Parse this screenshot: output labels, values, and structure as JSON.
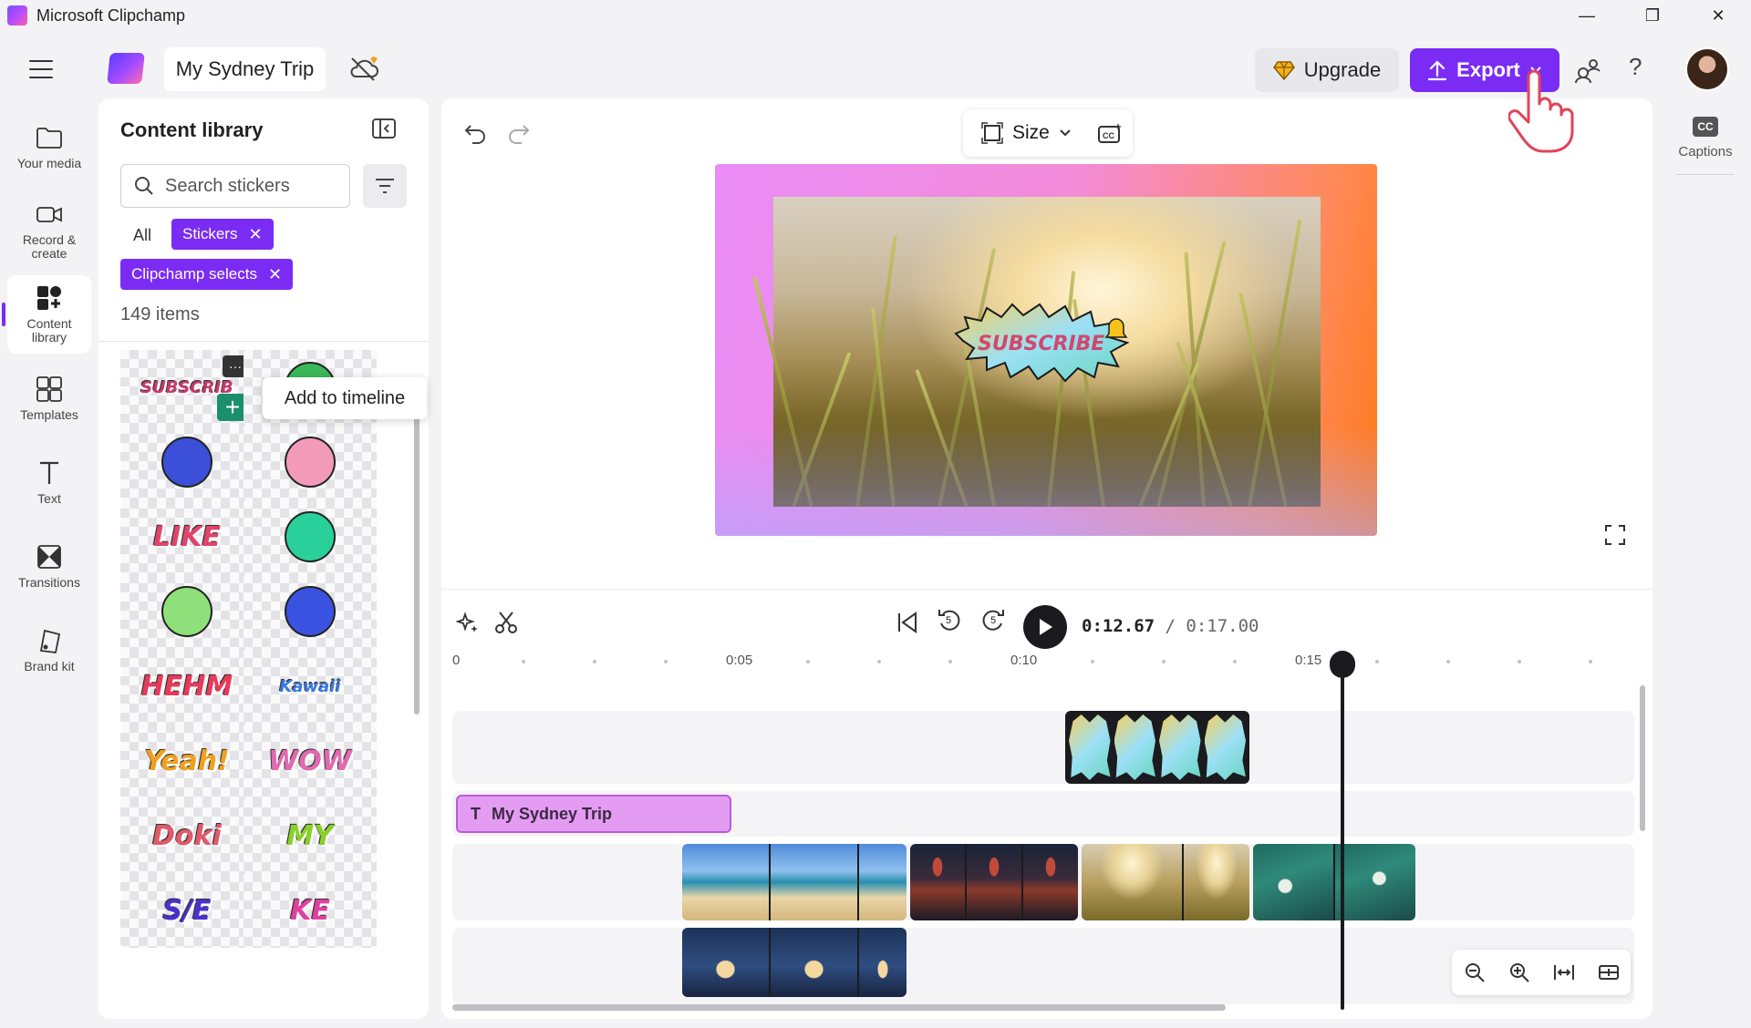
{
  "app": {
    "title": "Microsoft Clipchamp"
  },
  "window_controls": {
    "minimize": "—",
    "restore": "❐",
    "close": "✕"
  },
  "topbar": {
    "project_title": "My Sydney Trip",
    "upgrade_label": "Upgrade",
    "export_label": "Export",
    "help_label": "?"
  },
  "left_rail": [
    {
      "icon": "folder-icon",
      "label": "Your media"
    },
    {
      "icon": "camera-icon",
      "label": "Record &\ncreate"
    },
    {
      "icon": "content-library-icon",
      "label": "Content\nlibrary",
      "active": true
    },
    {
      "icon": "templates-icon",
      "label": "Templates"
    },
    {
      "icon": "text-icon",
      "label": "Text"
    },
    {
      "icon": "transitions-icon",
      "label": "Transitions"
    },
    {
      "icon": "brand-kit-icon",
      "label": "Brand kit"
    }
  ],
  "library": {
    "title": "Content library",
    "search_placeholder": "Search stickers",
    "filter_all": "All",
    "chips": [
      "Stickers",
      "Clipchamp selects"
    ],
    "items_count": "149 items",
    "tooltip": "Add to timeline",
    "more_label": "···",
    "add_label": "+",
    "tiles": [
      {
        "name": "subscribe-sticker",
        "text": "SUBSCRIB",
        "color": "#c73a6a"
      },
      {
        "name": "rocket-sticker",
        "text": "",
        "color": "#3ab85a"
      },
      {
        "name": "planet-sticker",
        "text": "",
        "color": "#3b4fd8"
      },
      {
        "name": "face-sticker",
        "text": "",
        "color": "#f29ab8"
      },
      {
        "name": "like-heart-sticker",
        "text": "LIKE",
        "color": "#e0446a"
      },
      {
        "name": "sparkle-sticker",
        "text": "",
        "color": "#2ad09a"
      },
      {
        "name": "smiley-sticker",
        "text": "",
        "color": "#8fe07a"
      },
      {
        "name": "bomb-sticker",
        "text": "",
        "color": "#3a52e0"
      },
      {
        "name": "hehm-sticker",
        "text": "HEHM",
        "color": "#e83a5a"
      },
      {
        "name": "kawaii-sticker",
        "text": "Kawaii",
        "color": "#3a7ae0"
      },
      {
        "name": "yeah-sticker",
        "text": "Yeah!",
        "color": "#f0a020"
      },
      {
        "name": "wow-sticker",
        "text": "WOW",
        "color": "#e06ab0"
      },
      {
        "name": "doki-sticker",
        "text": "Doki",
        "color": "#e05a6a"
      },
      {
        "name": "my-them-sticker",
        "text": "MY",
        "color": "#8ad02a"
      },
      {
        "name": "se-sticker",
        "text": "S/E",
        "color": "#4a30d0"
      },
      {
        "name": "ke-sticker",
        "text": "KE",
        "color": "#e040a0"
      }
    ]
  },
  "editor": {
    "size_label": "Size",
    "preview_sticker_text": "SUBSCRIBE",
    "time_current": "0:12.67",
    "time_total": " / 0:17.00",
    "skip_back_label": "5",
    "skip_fwd_label": "5",
    "ruler": [
      "0",
      "0:05",
      "0:10",
      "0:15"
    ],
    "text_clip_label": "My Sydney Trip",
    "text_clip_icon": "T"
  },
  "right_rail": {
    "captions_badge": "CC",
    "captions_label": "Captions"
  },
  "colors": {
    "accent": "#7b2cf4",
    "add_green": "#1a8f6a"
  }
}
